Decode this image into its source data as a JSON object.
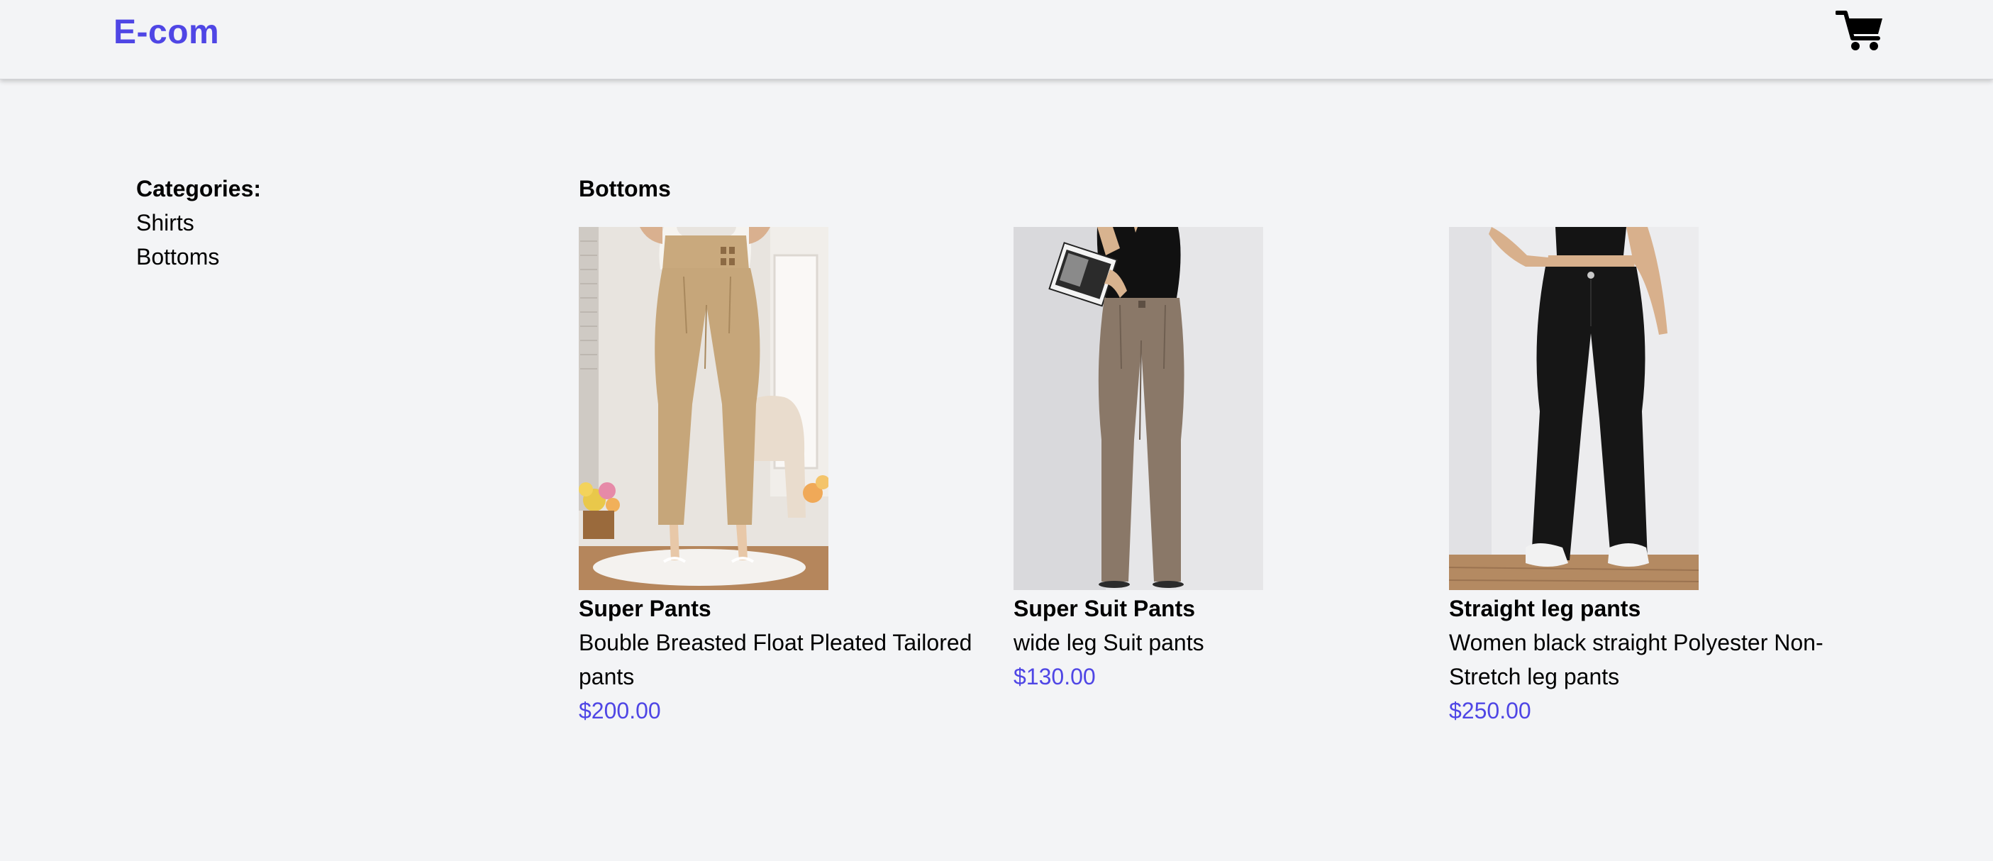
{
  "header": {
    "brand": "E-com",
    "cart_icon": "shopping-cart-icon",
    "brand_color": "#4f46e5"
  },
  "sidebar": {
    "title": "Categories:",
    "items": [
      {
        "label": "Shirts"
      },
      {
        "label": "Bottoms"
      }
    ]
  },
  "main": {
    "section_title": "Bottoms",
    "products": [
      {
        "name": "Super Pants",
        "description": "Bouble Breasted Float Pleated Tailored pants",
        "price": "$200.00",
        "image": "beige-tailored-pants-photo"
      },
      {
        "name": "Super Suit Pants",
        "description": "wide leg Suit pants",
        "price": "$130.00",
        "image": "taupe-wide-leg-suit-pants-photo"
      },
      {
        "name": "Straight leg pants",
        "description": "Women black straight Polyester Non-Stretch leg pants",
        "price": "$250.00",
        "image": "black-straight-leg-pants-photo"
      }
    ]
  }
}
